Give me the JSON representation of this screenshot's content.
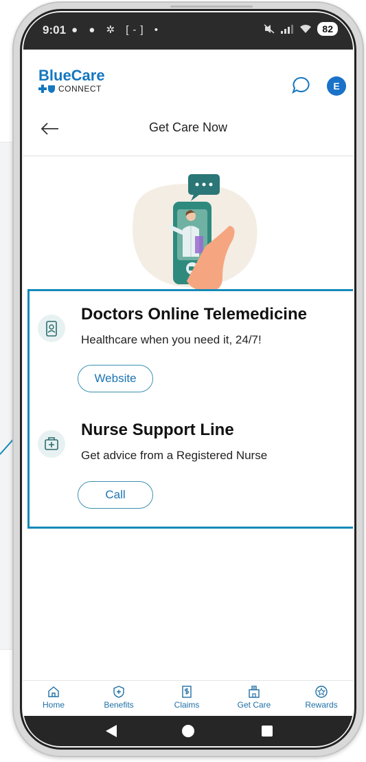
{
  "status_bar": {
    "time": "9:01",
    "left_icons": "● ● ✲ [-] •",
    "battery": "82"
  },
  "app": {
    "brand": "BlueCare",
    "brand_sub": "CONNECT",
    "avatar_letter": "E"
  },
  "page": {
    "title": "Get Care Now"
  },
  "cards": [
    {
      "title": "Doctors Online Telemedicine",
      "description": "Healthcare when you need it, 24/7!",
      "button": "Website",
      "icon": "phone-doctor-icon"
    },
    {
      "title": "Nurse Support Line",
      "description": "Get advice from a Registered Nurse",
      "button": "Call",
      "icon": "medical-kit-icon"
    }
  ],
  "bottom_nav": [
    {
      "label": "Home",
      "icon": "home-icon"
    },
    {
      "label": "Benefits",
      "icon": "shield-plus-icon"
    },
    {
      "label": "Claims",
      "icon": "dollar-document-icon"
    },
    {
      "label": "Get Care",
      "icon": "hospital-icon"
    },
    {
      "label": "Rewards",
      "icon": "star-badge-icon"
    }
  ],
  "colors": {
    "brand_blue": "#1577bf",
    "highlight_border": "#1389b9",
    "nav_text": "#1f6fa6"
  }
}
